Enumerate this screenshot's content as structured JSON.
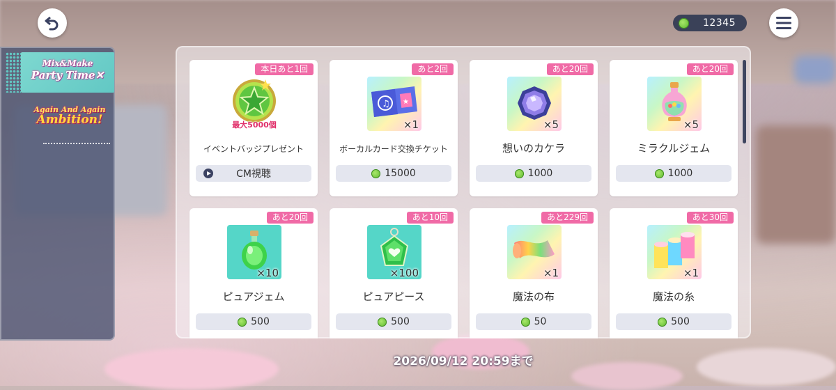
{
  "header": {
    "back_icon": "back-arrow-icon",
    "menu_icon": "hamburger-menu-icon",
    "currency": {
      "icon": "green-gem-coin-icon",
      "amount": "12345"
    }
  },
  "sidebar": {
    "tabs": [
      {
        "logo_text": "Mix&Make Party Time",
        "active": true
      },
      {
        "logo_text_top": "Again And Again",
        "logo_text_main": "Ambition!",
        "active": false
      }
    ]
  },
  "items": [
    {
      "badge": "本日あと1回",
      "name": "イベントバッジプレゼント",
      "icon": "star-badge-icon",
      "icon_caption": "最大5000個",
      "qty": "",
      "action": "CM視聴",
      "action_icon": "play-icon"
    },
    {
      "badge": "あと2回",
      "name": "ボーカルカード交換チケット",
      "icon": "vocal-card-ticket-icon",
      "qty": "×1",
      "price": "15000",
      "price_icon": "green-gem-coin-icon"
    },
    {
      "badge": "あと20回",
      "name": "想いのカケラ",
      "icon": "purple-crystal-icon",
      "qty": "×5",
      "price": "1000",
      "price_icon": "green-gem-coin-icon"
    },
    {
      "badge": "あと20回",
      "name": "ミラクルジェム",
      "icon": "rainbow-bottle-icon",
      "qty": "×5",
      "price": "1000",
      "price_icon": "green-gem-coin-icon"
    },
    {
      "badge": "あと20回",
      "name": "ピュアジェム",
      "icon": "green-potion-icon",
      "qty": "×10",
      "price": "500",
      "price_icon": "green-gem-coin-icon"
    },
    {
      "badge": "あと10回",
      "name": "ピュアピース",
      "icon": "green-pendant-icon",
      "qty": "×100",
      "price": "500",
      "price_icon": "green-gem-coin-icon"
    },
    {
      "badge": "あと229回",
      "name": "魔法の布",
      "icon": "rainbow-cloth-icon",
      "qty": "×1",
      "price": "50",
      "price_icon": "green-gem-coin-icon"
    },
    {
      "badge": "あと30回",
      "name": "魔法の糸",
      "icon": "thread-spools-icon",
      "qty": "×1",
      "price": "500",
      "price_icon": "green-gem-coin-icon"
    }
  ],
  "footer": {
    "deadline": "2026/09/12 20:59まで"
  },
  "colors": {
    "badge": "#f06aa6",
    "sidebar": "#46506e",
    "accent_teal": "#62c8c4"
  }
}
